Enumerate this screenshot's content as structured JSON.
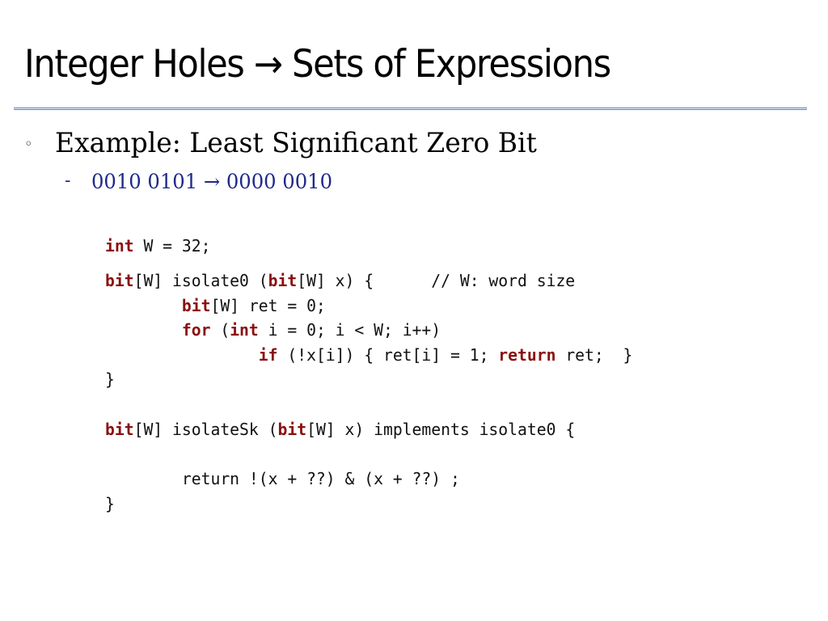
{
  "slide": {
    "title": "Integer Holes → Sets of Expressions",
    "bullet_icon": "hollow-circle-bullet",
    "bullet_symbol": "◦",
    "bullet_text": "Example: Least Significant Zero Bit",
    "sub_bullet_dash": "-",
    "sub_bullet_text": "0010 0101  → 0000 0010"
  },
  "colors": {
    "keyword": "#8b0f0f",
    "sub_bullet": "#1f2a8a",
    "divider": "#4f81bd"
  },
  "code": {
    "line1": [
      {
        "kw": "int"
      },
      {
        "t": " W = 32;"
      }
    ],
    "block1": [
      [
        {
          "kw": "bit"
        },
        {
          "t": "[W] isolate0 ("
        },
        {
          "kw": "bit"
        },
        {
          "t": "[W] x) {      // W: word size"
        }
      ],
      [
        {
          "t": "        "
        },
        {
          "kw": "bit"
        },
        {
          "t": "[W] ret = 0;"
        }
      ],
      [
        {
          "t": "        "
        },
        {
          "kw": "for"
        },
        {
          "t": " ("
        },
        {
          "kw": "int"
        },
        {
          "t": " i = 0; i < W; i++)"
        }
      ],
      [
        {
          "t": "                "
        },
        {
          "kw": "if"
        },
        {
          "t": " (!x[i]) { ret[i] = 1; "
        },
        {
          "kw": "return"
        },
        {
          "t": " ret;  }"
        }
      ],
      [
        {
          "t": "}"
        }
      ]
    ],
    "block2": [
      [
        {
          "kw": "bit"
        },
        {
          "t": "[W] isolateSk ("
        },
        {
          "kw": "bit"
        },
        {
          "t": "[W] x) implements isolate0 {"
        }
      ],
      [
        {
          "t": ""
        }
      ],
      [
        {
          "t": "        return !(x + ??) & (x + ??) ;"
        }
      ],
      [
        {
          "t": "}"
        }
      ]
    ]
  }
}
